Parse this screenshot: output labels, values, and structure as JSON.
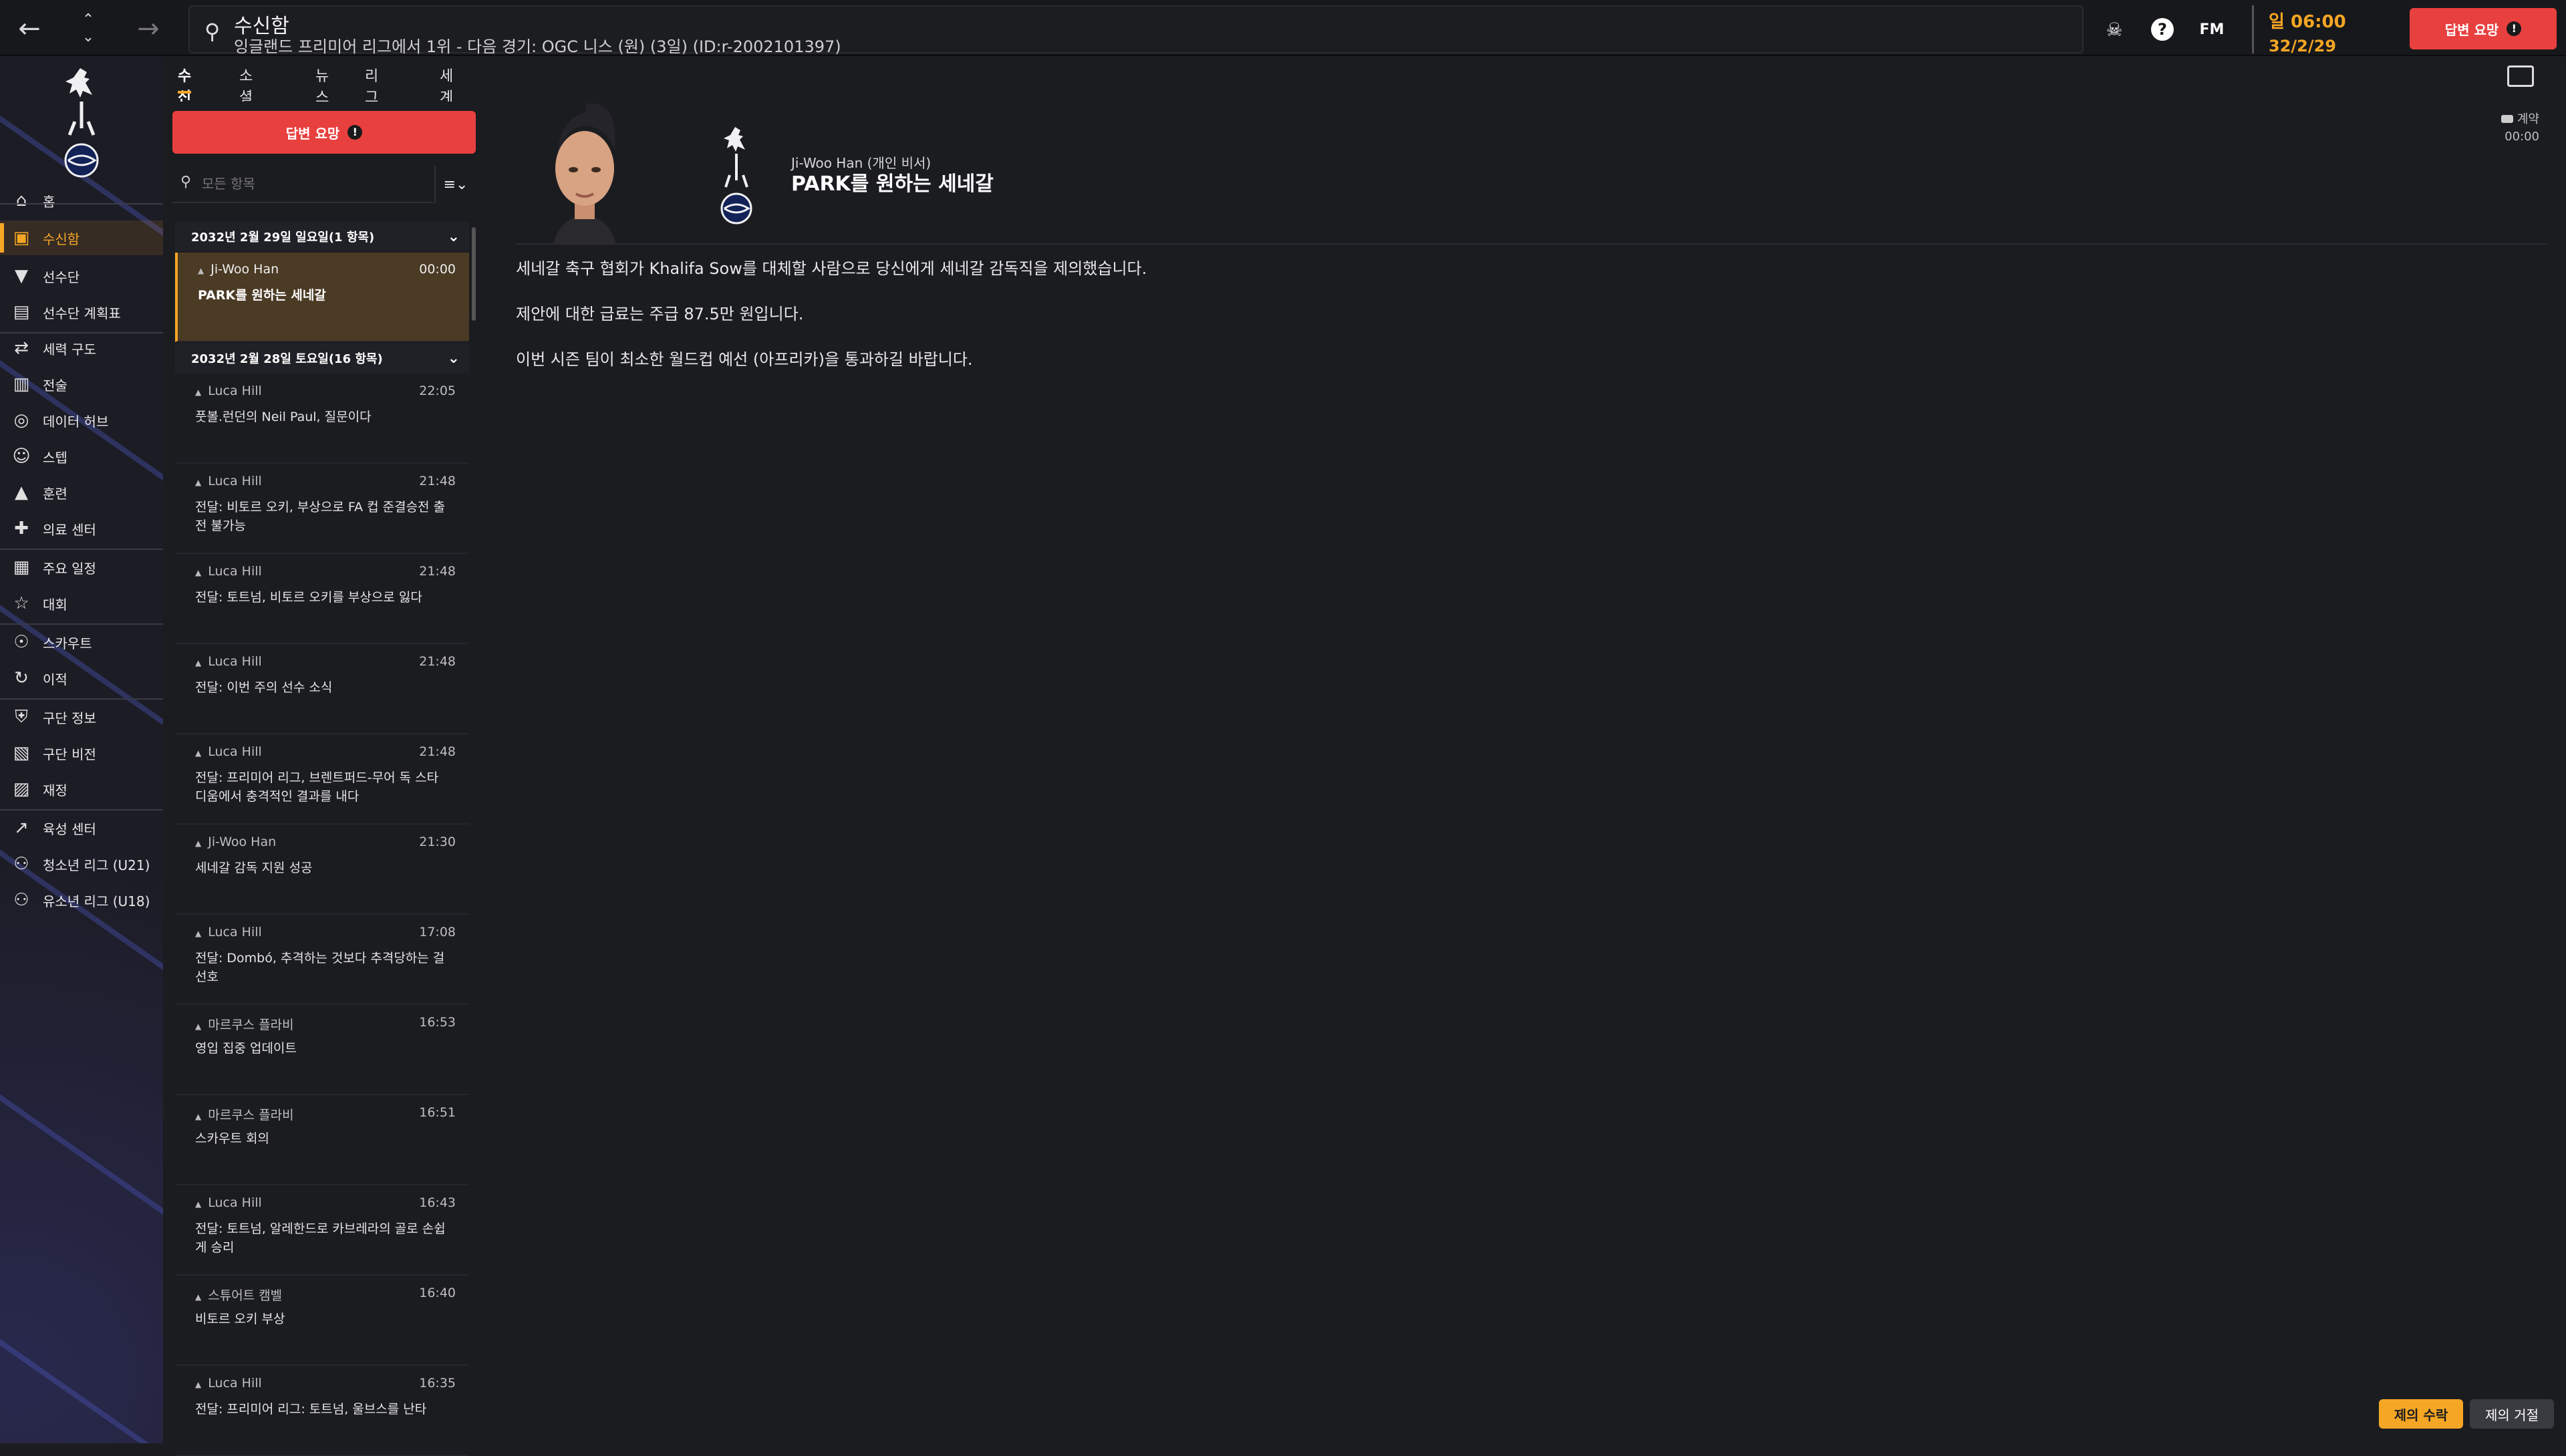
{
  "header": {
    "title": "수신함",
    "subtitle": "잉글랜드 프리미어 리그에서 1위 - 다음 경기: OGC 니스 (원) (3일) (ID:r-2002101397)",
    "fm_label": "FM",
    "clock_time": "일 06:00",
    "clock_date": "32/2/29",
    "cta_label": "답변 요망"
  },
  "sidebar": {
    "items": [
      {
        "label": "홈",
        "icon": "home-icon"
      },
      {
        "label": "수신함",
        "icon": "inbox-icon",
        "active": true
      },
      {
        "label": "선수단",
        "icon": "shirt-icon"
      },
      {
        "label": "선수단 계획표",
        "icon": "clipboard-icon"
      },
      {
        "label": "세력 구도",
        "icon": "dynamics-icon"
      },
      {
        "label": "전술",
        "icon": "tactics-icon"
      },
      {
        "label": "데이터 허브",
        "icon": "data-icon"
      },
      {
        "label": "스텝",
        "icon": "staff-icon"
      },
      {
        "label": "훈련",
        "icon": "training-icon"
      },
      {
        "label": "의료 센터",
        "icon": "medical-icon"
      },
      {
        "label": "주요 일정",
        "icon": "calendar-icon"
      },
      {
        "label": "대회",
        "icon": "trophy-icon"
      },
      {
        "label": "스카우트",
        "icon": "scout-icon"
      },
      {
        "label": "이적",
        "icon": "transfer-icon"
      },
      {
        "label": "구단 정보",
        "icon": "shield-icon"
      },
      {
        "label": "구단 비전",
        "icon": "vision-icon"
      },
      {
        "label": "재정",
        "icon": "finance-icon"
      },
      {
        "label": "육성 센터",
        "icon": "development-icon"
      },
      {
        "label": "청소년 리그 (U21)",
        "icon": "u21-icon"
      },
      {
        "label": "유소년 리그 (U18)",
        "icon": "u18-icon"
      }
    ]
  },
  "tabs": [
    "수신함",
    "소셜 피드",
    "뉴스",
    "리그 소식",
    "세계 소식"
  ],
  "list": {
    "reply_button": "답변 요망",
    "search_placeholder": "모든 항목",
    "group1": "2032년 2월 29일 일요일(1 항목)",
    "group2": "2032년 2월 28일 토요일(16 항목)",
    "messages": [
      {
        "from": "Ji-Woo Han",
        "time": "00:00",
        "subject": "PARK를 원하는 세네갈"
      },
      {
        "from": "Luca Hill",
        "time": "22:05",
        "subject": "풋볼.런던의 Neil Paul, 질문이다"
      },
      {
        "from": "Luca Hill",
        "time": "21:48",
        "subject": "전달: 비토르 오키, 부상으로 FA 컵 준결승전 출전 불가능"
      },
      {
        "from": "Luca Hill",
        "time": "21:48",
        "subject": "전달: 토트넘, 비토르 오키를 부상으로 잃다"
      },
      {
        "from": "Luca Hill",
        "time": "21:48",
        "subject": "전달: 이번 주의 선수 소식"
      },
      {
        "from": "Luca Hill",
        "time": "21:48",
        "subject": "전달: 프리미어 리그, 브렌트퍼드-무어 독 스타디움에서 충격적인 결과를 내다"
      },
      {
        "from": "Ji-Woo Han",
        "time": "21:30",
        "subject": "세네갈 감독 지원 성공"
      },
      {
        "from": "Luca Hill",
        "time": "17:08",
        "subject": "전달: Dombó, 추격하는 것보다 추격당하는 걸 선호"
      },
      {
        "from": "마르쿠스 플라비",
        "time": "16:53",
        "subject": "영입 집중 업데이트"
      },
      {
        "from": "마르쿠스 플라비",
        "time": "16:51",
        "subject": "스카우트 회의"
      },
      {
        "from": "Luca Hill",
        "time": "16:43",
        "subject": "전달: 토트넘, 알레한드로 카브레라의 골로 손쉽게 승리"
      },
      {
        "from": "스튜어트 캠벨",
        "time": "16:40",
        "subject": "비토르 오키 부상"
      },
      {
        "from": "Luca Hill",
        "time": "16:35",
        "subject": "전달: 프리미어 리그: 토트넘, 울브스를 난타"
      }
    ]
  },
  "detail": {
    "sender": "Ji-Woo Han (개인 비서)",
    "subject": "PARK를 원하는 세네갈",
    "meta_label": "계약",
    "meta_time": "00:00",
    "body": [
      "세네갈 축구 협회가 Khalifa Sow를 대체할 사람으로 당신에게 세네갈 감독직을 제의했습니다.",
      "제안에 대한 급료는 주급 87.5만 원입니다.",
      "이번 시즌 팀이 최소한 월드컵 예선 (아프리카)을 통과하길 바랍니다."
    ],
    "accept": "제의 수락",
    "reject": "제의 거절"
  },
  "colors": {
    "accent": "#f5a624",
    "alert": "#e8403f",
    "background": "#1b1c20",
    "club_navy": "#132257"
  }
}
